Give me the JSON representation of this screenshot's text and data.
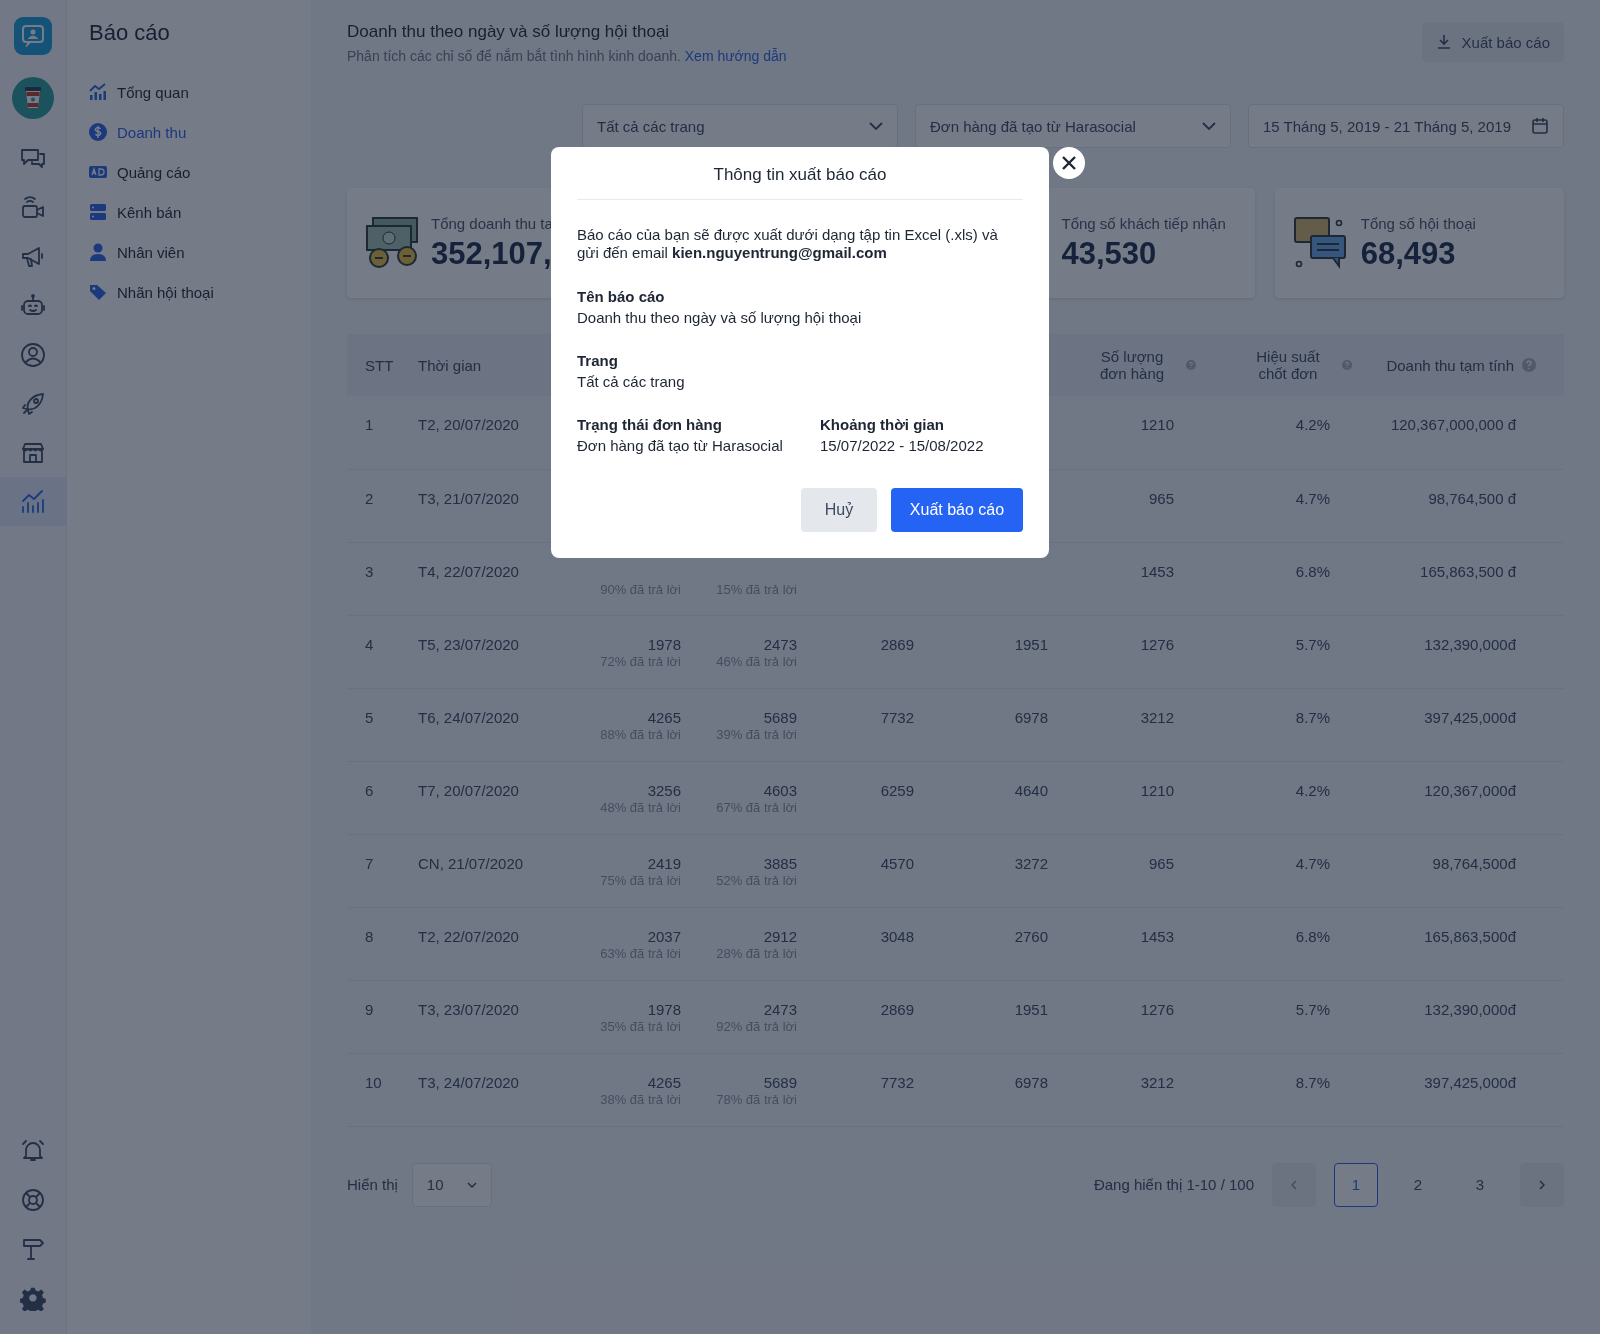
{
  "rail": [
    {
      "selected": false
    },
    {
      "selected": false
    },
    {
      "selected": false
    },
    {
      "selected": false
    },
    {
      "selected": false
    },
    {
      "selected": false
    },
    {
      "selected": false
    },
    {
      "selected": true
    },
    {
      "selected": false
    },
    {
      "selected": false
    },
    {
      "selected": false
    },
    {
      "selected": false
    }
  ],
  "nav": {
    "title": "Báo cáo",
    "items": [
      {
        "label": "Tổng quan",
        "selected": false
      },
      {
        "label": "Doanh thu",
        "selected": true
      },
      {
        "label": "Quảng cáo",
        "selected": false
      },
      {
        "label": "Kênh bán",
        "selected": false
      },
      {
        "label": "Nhân viên",
        "selected": false
      },
      {
        "label": "Nhãn hội thoại",
        "selected": false
      }
    ]
  },
  "header": {
    "title": "Doanh thu theo ngày và số lượng hội thoại",
    "subtitle": "Phân tích các chỉ số để nắm bắt tình hình kinh doanh.",
    "link": "Xem hướng dẫn",
    "export_button": "Xuất báo cáo"
  },
  "filters": {
    "page": "Tất cả các trang",
    "order_status": "Đơn hàng đã tạo từ Harasocial",
    "date_range": "15 Tháng 5, 2019 - 21 Tháng 5, 2019"
  },
  "stat_cards": [
    {
      "title": "Tổng doanh thu ta",
      "value": "352,107,"
    },
    {
      "title": "Tổng số khách tiếp nhận",
      "value": "43,530"
    },
    {
      "title": "Tổng số hội thoại",
      "value": "68,493"
    }
  ],
  "table": {
    "columns": [
      {
        "label": "STT"
      },
      {
        "label": "Thời gian"
      },
      {},
      {},
      {},
      {},
      {
        "label": "Số lượng đơn hàng",
        "help": true
      },
      {
        "label": "Hiệu suất chốt đơn",
        "help": true
      },
      {
        "label": "Doanh thu tạm tính",
        "help": true
      }
    ],
    "rows": [
      {
        "cells": [
          {
            "value": "1"
          },
          {
            "value": "T2, 20/07/2020"
          },
          {},
          {},
          {},
          {},
          {
            "value": "1210"
          },
          {
            "value": "4.2%"
          },
          {
            "value": "120,367,000,000 đ"
          }
        ]
      },
      {
        "cells": [
          {
            "value": "2"
          },
          {
            "value": "T3, 21/07/2020"
          },
          {},
          {},
          {},
          {},
          {
            "value": "965"
          },
          {
            "value": "4.7%"
          },
          {
            "value": "98,764,500 đ"
          }
        ]
      },
      {
        "cells": [
          {
            "value": "3"
          },
          {
            "value": "T4, 22/07/2020"
          },
          {
            "note": "90% đã trả lời"
          },
          {
            "note": "15% đã trả lời"
          },
          {},
          {},
          {
            "value": "1453"
          },
          {
            "value": "6.8%"
          },
          {
            "value": "165,863,500 đ"
          }
        ]
      },
      {
        "cells": [
          {
            "value": "4"
          },
          {
            "value": "T5, 23/07/2020"
          },
          {
            "value": "1978",
            "note": "72% đã trả lời"
          },
          {
            "value": "2473",
            "note": "46% đã trả lời"
          },
          {
            "value": "2869"
          },
          {
            "value": "1951"
          },
          {
            "value": "1276"
          },
          {
            "value": "5.7%"
          },
          {
            "value": "132,390,000đ"
          }
        ]
      },
      {
        "cells": [
          {
            "value": "5"
          },
          {
            "value": "T6, 24/07/2020"
          },
          {
            "value": "4265",
            "note": "88% đã trả lời"
          },
          {
            "value": "5689",
            "note": "39% đã trả lời"
          },
          {
            "value": "7732"
          },
          {
            "value": "6978"
          },
          {
            "value": "3212"
          },
          {
            "value": "8.7%"
          },
          {
            "value": "397,425,000đ"
          }
        ]
      },
      {
        "cells": [
          {
            "value": "6"
          },
          {
            "value": "T7, 20/07/2020"
          },
          {
            "value": "3256",
            "note": "48% đã trả lời"
          },
          {
            "value": "4603",
            "note": "67% đã trả lời"
          },
          {
            "value": "6259"
          },
          {
            "value": "4640"
          },
          {
            "value": "1210"
          },
          {
            "value": "4.2%"
          },
          {
            "value": "120,367,000đ"
          }
        ]
      },
      {
        "cells": [
          {
            "value": "7"
          },
          {
            "value": "CN, 21/07/2020"
          },
          {
            "value": "2419",
            "note": "75% đã trả lời"
          },
          {
            "value": "3885",
            "note": "52% đã trả lời"
          },
          {
            "value": "4570"
          },
          {
            "value": "3272"
          },
          {
            "value": "965"
          },
          {
            "value": "4.7%"
          },
          {
            "value": "98,764,500đ"
          }
        ]
      },
      {
        "cells": [
          {
            "value": "8"
          },
          {
            "value": "T2, 22/07/2020"
          },
          {
            "value": "2037",
            "note": "63% đã trả lời"
          },
          {
            "value": "2912",
            "note": "28% đã trả lời"
          },
          {
            "value": "3048"
          },
          {
            "value": "2760"
          },
          {
            "value": "1453"
          },
          {
            "value": "6.8%"
          },
          {
            "value": "165,863,500đ"
          }
        ]
      },
      {
        "cells": [
          {
            "value": "9"
          },
          {
            "value": "T3, 23/07/2020"
          },
          {
            "value": "1978",
            "note": "35% đã trả lời"
          },
          {
            "value": "2473",
            "note": "92% đã trả lời"
          },
          {
            "value": "2869"
          },
          {
            "value": "1951"
          },
          {
            "value": "1276"
          },
          {
            "value": "5.7%"
          },
          {
            "value": "132,390,000đ"
          }
        ]
      },
      {
        "cells": [
          {
            "value": "10"
          },
          {
            "value": "T3, 24/07/2020"
          },
          {
            "value": "4265",
            "note": "38% đã trả lời"
          },
          {
            "value": "5689",
            "note": "78% đã trả lời"
          },
          {
            "value": "7732"
          },
          {
            "value": "6978"
          },
          {
            "value": "3212"
          },
          {
            "value": "8.7%"
          },
          {
            "value": "397,425,000đ"
          }
        ]
      }
    ]
  },
  "pagination": {
    "show_label": "Hiển thị",
    "page_size": "10",
    "summary": "Đang hiển thị 1-10 / 100",
    "pages": [
      {
        "label": "1",
        "selected": true
      },
      {
        "label": "2",
        "selected": false
      },
      {
        "label": "3",
        "selected": false
      }
    ]
  },
  "dialog": {
    "title": "Thông tin xuất báo cáo",
    "message": "Báo cáo của bạn sẽ được xuất dưới dạng tập tin Excel (.xls) và gửi đến email **kien.nguyentrung@gmail.com**",
    "fields": [
      {
        "label": "Tên báo cáo",
        "value": "Doanh thu theo ngày và số lượng hội thoại"
      },
      {
        "label": "Trang",
        "value": "Tất cả các trang"
      },
      {
        "label": "Trạng thái đơn hàng",
        "value": "Đơn hàng đã tạo từ Harasocial"
      },
      {
        "label": "Khoảng thời gian",
        "value": "15/07/2022 - 15/08/2022"
      }
    ],
    "cancel_button": "Huỷ",
    "confirm_button": "Xuất báo cáo"
  }
}
